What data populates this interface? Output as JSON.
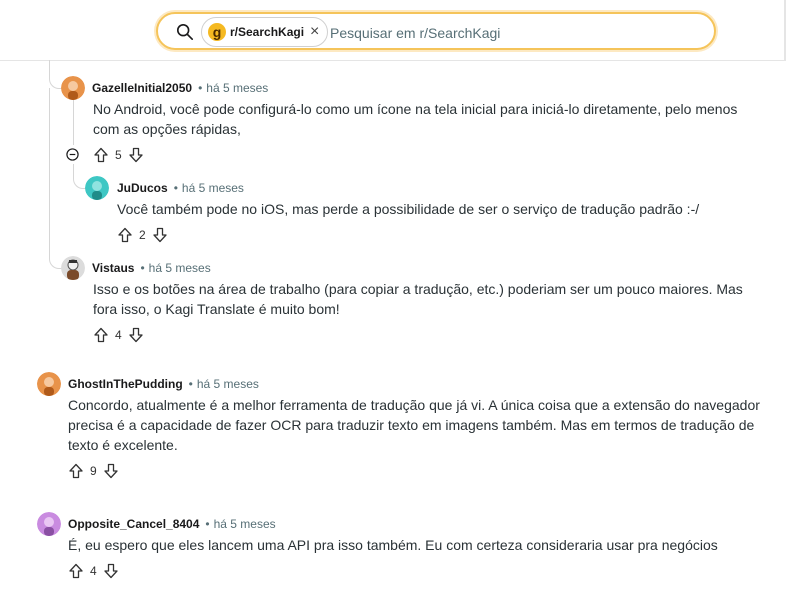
{
  "search": {
    "subreddit": "r/SearchKagi",
    "logo_letter": "g",
    "placeholder": "Pesquisar em r/SearchKagi"
  },
  "comments": [
    {
      "author": "GazelleInitial2050",
      "time": "há 5 meses",
      "body": "No Android, você pode configurá-lo como um ícone na tela inicial para iniciá-lo diretamente, pelo menos com as opções rápidas,",
      "votes": "5",
      "avatar_color": "#e8934a"
    },
    {
      "author": "JuDucos",
      "time": "há 5 meses",
      "body": "Você também pode no iOS, mas perde a possibilidade de ser o serviço de tradução padrão :-/",
      "votes": "2",
      "avatar_color": "#3ec7c4"
    },
    {
      "author": "Vistaus",
      "time": "há 5 meses",
      "body": "Isso e os botões na área de trabalho (para copiar a tradução, etc.) poderiam ser um pouco maiores. Mas fora isso, o Kagi Translate é muito bom!",
      "votes": "4",
      "avatar_color": "#6b6b6b"
    },
    {
      "author": "GhostInThePudding",
      "time": "há 5 meses",
      "body": "Concordo, atualmente é a melhor ferramenta de tradução que já vi. A única coisa que a extensão do navegador precisa é a capacidade de fazer OCR para traduzir texto em imagens também. Mas em termos de tradução de texto é excelente.",
      "votes": "9",
      "avatar_color": "#e8934a"
    },
    {
      "author": "Opposite_Cancel_8404",
      "time": "há 5 meses",
      "body": "É, eu espero que eles lancem uma API pra isso também. Eu com certeza consideraria usar pra negócios",
      "votes": "4",
      "avatar_color": "#c98be0"
    }
  ]
}
